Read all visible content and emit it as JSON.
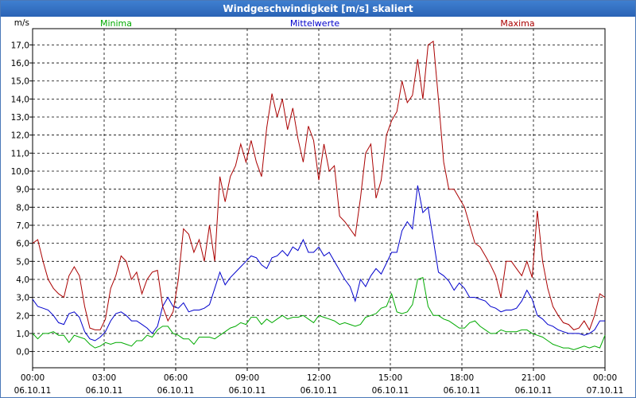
{
  "window": {
    "title": "Windgeschwindigkeit [m/s] skaliert"
  },
  "colors": {
    "minima": "#00aa00",
    "mittelwerte": "#0000cc",
    "maxima": "#aa0000"
  },
  "chart_data": {
    "type": "line",
    "ylabel": "m/s",
    "ylim": [
      -0.9,
      17.9
    ],
    "yticks": [
      "0,0",
      "1,0",
      "2,0",
      "3,0",
      "4,0",
      "5,0",
      "6,0",
      "7,0",
      "8,0",
      "9,0",
      "10,0",
      "11,0",
      "12,0",
      "13,0",
      "14,0",
      "15,0",
      "16,0",
      "17,0"
    ],
    "x_start_hour": 0,
    "x_end_hour": 24,
    "xticks": [
      {
        "time": "00:00",
        "date": "06.10.11"
      },
      {
        "time": "03:00",
        "date": "06.10.11"
      },
      {
        "time": "06:00",
        "date": "06.10.11"
      },
      {
        "time": "09:00",
        "date": "06.10.11"
      },
      {
        "time": "12:00",
        "date": "06.10.11"
      },
      {
        "time": "15:00",
        "date": "06.10.11"
      },
      {
        "time": "18:00",
        "date": "06.10.11"
      },
      {
        "time": "21:00",
        "date": "06.10.11"
      },
      {
        "time": "00:00",
        "date": "07.10.11"
      }
    ],
    "grid": true,
    "series": [
      {
        "name": "Minima",
        "color": "#00aa00",
        "values": [
          1.0,
          0.7,
          1.0,
          1.0,
          1.1,
          0.9,
          0.9,
          0.5,
          0.9,
          0.8,
          0.7,
          0.4,
          0.2,
          0.3,
          0.5,
          0.4,
          0.5,
          0.5,
          0.4,
          0.3,
          0.6,
          0.6,
          0.9,
          0.8,
          1.2,
          1.4,
          1.4,
          1.0,
          0.9,
          0.7,
          0.7,
          0.4,
          0.8,
          0.8,
          0.8,
          0.7,
          0.9,
          1.1,
          1.3,
          1.4,
          1.6,
          1.5,
          1.9,
          1.9,
          1.5,
          1.8,
          1.6,
          1.8,
          2.0,
          1.8,
          1.9,
          1.9,
          2.0,
          1.8,
          1.6,
          2.0,
          1.9,
          1.8,
          1.7,
          1.5,
          1.6,
          1.5,
          1.4,
          1.5,
          1.9,
          2.0,
          2.1,
          2.4,
          2.5,
          3.2,
          2.2,
          2.1,
          2.2,
          2.6,
          4.0,
          4.1,
          2.5,
          2.0,
          2.0,
          1.8,
          1.7,
          1.5,
          1.3,
          1.3,
          1.6,
          1.7,
          1.4,
          1.2,
          1.0,
          1.0,
          1.2,
          1.1,
          1.1,
          1.1,
          1.2,
          1.2,
          1.0,
          0.9,
          0.8,
          0.6,
          0.4,
          0.3,
          0.2,
          0.2,
          0.1,
          0.2,
          0.3,
          0.2,
          0.3,
          0.2,
          0.9
        ]
      },
      {
        "name": "Mittelwerte",
        "color": "#0000cc",
        "values": [
          2.9,
          2.5,
          2.4,
          2.3,
          2.0,
          1.6,
          1.5,
          2.1,
          2.2,
          1.9,
          1.1,
          0.7,
          0.6,
          0.8,
          1.1,
          1.7,
          2.1,
          2.2,
          2.0,
          1.7,
          1.7,
          1.5,
          1.3,
          1.0,
          1.4,
          2.5,
          3.0,
          2.5,
          2.4,
          2.7,
          2.2,
          2.3,
          2.3,
          2.4,
          2.6,
          3.5,
          4.4,
          3.7,
          4.1,
          4.4,
          4.7,
          5.0,
          5.3,
          5.2,
          4.8,
          4.6,
          5.2,
          5.3,
          5.6,
          5.3,
          5.8,
          5.6,
          6.2,
          5.5,
          5.5,
          5.8,
          5.3,
          5.5,
          5.0,
          4.5,
          4.0,
          3.6,
          2.8,
          4.0,
          3.6,
          4.2,
          4.6,
          4.3,
          4.9,
          5.5,
          5.5,
          6.7,
          7.2,
          6.8,
          9.2,
          7.7,
          8.0,
          6.2,
          4.4,
          4.2,
          3.9,
          3.4,
          3.8,
          3.5,
          3.0,
          3.0,
          2.9,
          2.8,
          2.5,
          2.4,
          2.2,
          2.3,
          2.3,
          2.4,
          2.8,
          3.4,
          2.9,
          2.0,
          1.8,
          1.5,
          1.4,
          1.2,
          1.1,
          1.0,
          1.0,
          1.0,
          0.9,
          1.0,
          1.2,
          1.7,
          1.7
        ]
      },
      {
        "name": "Maxima",
        "color": "#aa0000",
        "values": [
          6.0,
          6.2,
          5.0,
          4.0,
          3.5,
          3.2,
          3.0,
          4.2,
          4.7,
          4.2,
          2.5,
          1.3,
          1.2,
          1.2,
          1.8,
          3.5,
          4.2,
          5.3,
          5.0,
          4.0,
          4.4,
          3.2,
          4.0,
          4.4,
          4.5,
          2.5,
          1.7,
          2.2,
          4.0,
          6.8,
          6.5,
          5.5,
          6.2,
          5.0,
          7.0,
          5.0,
          9.7,
          8.3,
          9.7,
          10.3,
          11.5,
          10.5,
          11.7,
          10.5,
          9.7,
          12.4,
          14.3,
          13.0,
          14.0,
          12.3,
          13.5,
          11.8,
          10.5,
          12.5,
          11.7,
          9.5,
          11.5,
          10.0,
          10.3,
          7.5,
          7.2,
          6.8,
          6.4,
          8.5,
          11.0,
          11.5,
          8.5,
          9.5,
          12.0,
          12.8,
          13.3,
          15.0,
          13.8,
          14.2,
          16.2,
          14.0,
          17.0,
          17.2,
          14.0,
          10.5,
          9.0,
          9.0,
          8.5,
          8.0,
          7.0,
          6.0,
          5.8,
          5.3,
          4.8,
          4.2,
          3.0,
          5.0,
          5.0,
          4.6,
          4.2,
          5.0,
          4.1,
          7.8,
          5.0,
          3.5,
          2.5,
          2.0,
          1.6,
          1.5,
          1.2,
          1.3,
          1.7,
          1.2,
          2.0,
          3.2,
          3.0
        ]
      }
    ]
  }
}
